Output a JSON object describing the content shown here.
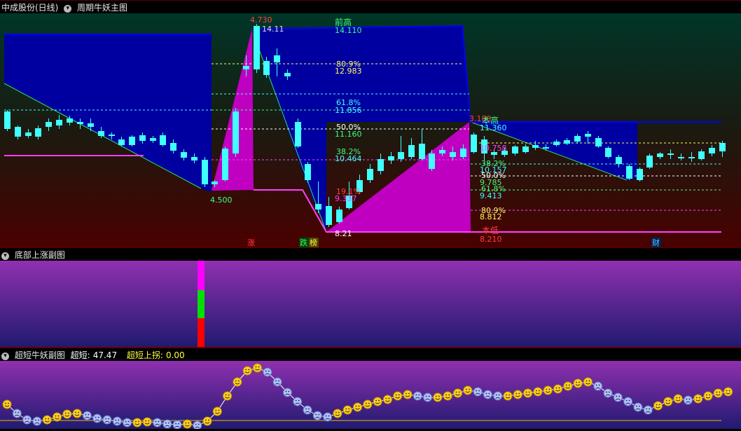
{
  "main": {
    "stock": "中成股份(日线)",
    "indicator": "周期牛妖主图",
    "prev_high_label": "前高",
    "this_high_label": "本高",
    "this_low_label": "本低",
    "price_labels": [
      "4.730",
      "14.11",
      "14.110",
      "80.9%",
      "12.983",
      "61.8%",
      "11.856",
      "50.0%",
      "11.160",
      "38.2%",
      "10.464",
      "19.1%",
      "9.337",
      "8.21",
      "4.500",
      "3.180",
      "11.360",
      "10.758",
      "38.2%",
      "10.157",
      "50.0%",
      "9.785",
      "61.8%",
      "9.413",
      "80.9%",
      "8.812",
      "8.210"
    ],
    "markers": [
      "涨",
      "跌",
      "榜",
      "财"
    ]
  },
  "sub1": {
    "title": "底部上涨副图"
  },
  "sub2": {
    "title": "超短牛妖副图",
    "super_label": "超短:",
    "super_value": "47.47",
    "up_label": "超短上拐:",
    "up_value": "0.00"
  },
  "colors": {
    "up": "#ff3c3c",
    "down": "#40ffff",
    "wedge": "#c000c0",
    "box": "#0000a0"
  }
}
